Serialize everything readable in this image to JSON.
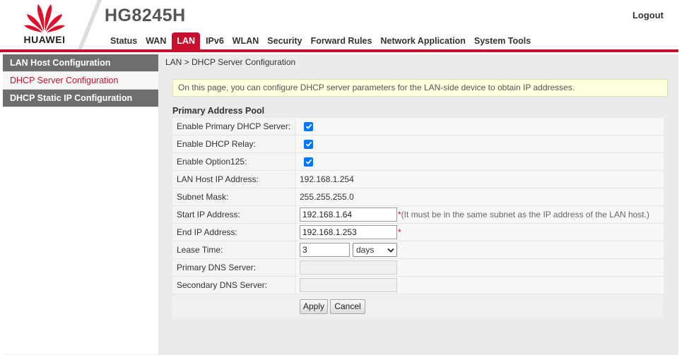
{
  "header": {
    "brand": "HUAWEI",
    "model": "HG8245H",
    "logout": "Logout",
    "nav": [
      "Status",
      "WAN",
      "LAN",
      "IPv6",
      "WLAN",
      "Security",
      "Forward Rules",
      "Network Application",
      "System Tools"
    ],
    "active_nav": "LAN",
    "accent_color": "#c8102e"
  },
  "sidebar": {
    "items": [
      {
        "label": "LAN Host Configuration"
      },
      {
        "label": "DHCP Server Configuration"
      },
      {
        "label": "DHCP Static IP Configuration"
      }
    ]
  },
  "breadcrumb": "LAN > DHCP Server Configuration",
  "notice": "On this page, you can configure DHCP server parameters for the LAN-side device to obtain IP addresses.",
  "pool": {
    "title": "Primary Address Pool",
    "enable_dhcp_label": "Enable Primary DHCP Server:",
    "enable_dhcp": true,
    "enable_relay_label": "Enable DHCP Relay:",
    "enable_relay": true,
    "enable_opt125_label": "Enable Option125:",
    "enable_opt125": true,
    "lan_ip_label": "LAN Host IP Address:",
    "lan_ip": "192.168.1.254",
    "subnet_label": "Subnet Mask:",
    "subnet": "255.255.255.0",
    "start_ip_label": "Start IP Address:",
    "start_ip": "192.168.1.64",
    "start_ip_hint": "(It must be in the same subnet as the IP address of the LAN host.)",
    "end_ip_label": "End IP Address:",
    "end_ip": "192.168.1.253",
    "required_mark": "*",
    "lease_label": "Lease Time:",
    "lease_value": "3",
    "lease_unit": "days",
    "dns1_label": "Primary DNS Server:",
    "dns1": "",
    "dns2_label": "Secondary DNS Server:",
    "dns2": ""
  },
  "buttons": {
    "apply": "Apply",
    "cancel": "Cancel"
  }
}
